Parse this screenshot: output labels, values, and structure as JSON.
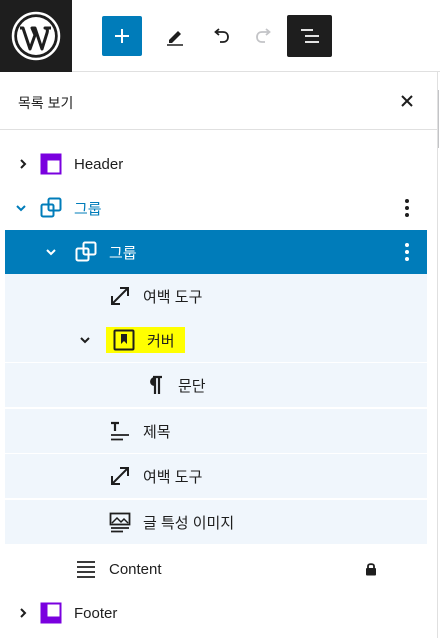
{
  "toolbar": {
    "logo_icon": "wordpress-logo",
    "add_icon": "plus-icon",
    "edit_icon": "pencil-icon",
    "undo_icon": "undo-icon",
    "redo_icon": "redo-icon",
    "listview_icon": "list-view-icon",
    "accent_color": "#007cba"
  },
  "panel": {
    "title": "목록 보기",
    "close_icon": "close-icon"
  },
  "tree": [
    {
      "label": "Header",
      "icon": "template-part-icon",
      "icon_color": "#7a00df",
      "expanded": false
    },
    {
      "label": "그룹",
      "icon": "group-icon",
      "icon_color": "#007cba",
      "expanded": true
    },
    {
      "label": "그룹",
      "icon": "group-icon",
      "expanded": true,
      "selected": true
    },
    {
      "label": "여백 도구",
      "icon": "spacer-icon"
    },
    {
      "label": "커버",
      "icon": "cover-icon",
      "expanded": true,
      "highlight_color": "#ffff00"
    },
    {
      "label": "문단",
      "icon": "paragraph-icon"
    },
    {
      "label": "제목",
      "icon": "post-title-icon"
    },
    {
      "label": "여백 도구",
      "icon": "spacer-icon"
    },
    {
      "label": "글 특성 이미지",
      "icon": "featured-image-icon"
    },
    {
      "label": "Content",
      "icon": "post-content-icon",
      "locked": true
    },
    {
      "label": "Footer",
      "icon": "template-part-icon",
      "icon_color": "#7a00df",
      "expanded": false
    }
  ]
}
